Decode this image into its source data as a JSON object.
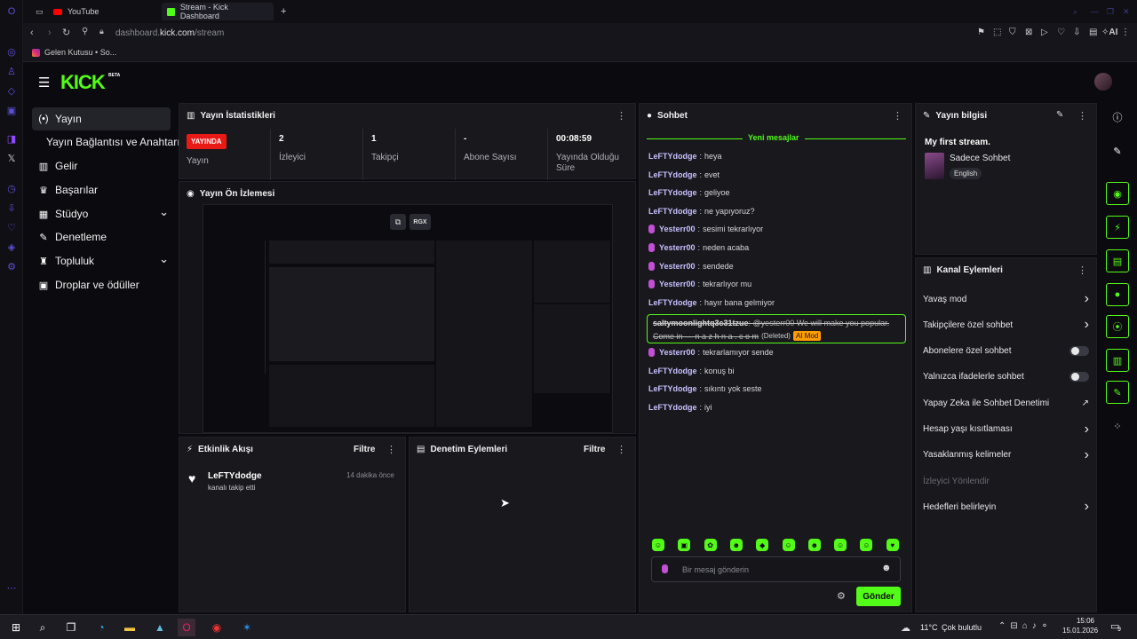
{
  "browser": {
    "tabs": [
      {
        "label": "YouTube"
      },
      {
        "label": "Stream - Kick Dashboard"
      }
    ],
    "new_tab_label": "+",
    "url_host": "dashboard.",
    "url_domain": "kick.com",
    "url_path": "/stream",
    "ai_label": "AI",
    "bookmark": "Gelen Kutusu • So..."
  },
  "kick": {
    "logo": "KICK",
    "beta": "BETA"
  },
  "sidebar": {
    "items": [
      {
        "label": "Yayın",
        "icon": "broadcast-icon"
      },
      {
        "label": "Yayın Bağlantısı ve Anahtarı",
        "icon": ""
      },
      {
        "label": "Gelir",
        "icon": "chart-icon"
      },
      {
        "label": "Başarılar",
        "icon": "trophy-icon"
      },
      {
        "label": "Stüdyo",
        "icon": "studio-icon",
        "chevron": "⌄"
      },
      {
        "label": "Denetleme",
        "icon": "wrench-icon"
      },
      {
        "label": "Topluluk",
        "icon": "community-icon",
        "chevron": "⌄"
      },
      {
        "label": "Droplar ve ödüller",
        "icon": "gift-icon"
      }
    ]
  },
  "stats": {
    "title": "Yayın İstatistikleri",
    "live_badge": "YAYINDA",
    "items": [
      {
        "value": "",
        "label": "Yayın"
      },
      {
        "value": "2",
        "label": "İzleyici"
      },
      {
        "value": "1",
        "label": "Takipçi"
      },
      {
        "value": "-",
        "label": "Abone Sayısı"
      },
      {
        "value": "00:08:59",
        "label": "Yayında Olduğu Süre"
      }
    ]
  },
  "preview": {
    "title": "Yayın Ön İzlemesi",
    "badge": "RGX"
  },
  "activity": {
    "title": "Etkinlik Akışı",
    "filter": "Filtre",
    "events": [
      {
        "user": "LeFTYdodge",
        "text": "kanalı takip etti",
        "time": "14 dakika önce"
      }
    ]
  },
  "moderation": {
    "title": "Denetim Eylemleri",
    "filter": "Filtre"
  },
  "chat": {
    "title": "Sohbet",
    "new_messages": "Yeni mesajlar",
    "messages": [
      {
        "user": "LeFTYdodge",
        "text": "heya",
        "mic": false
      },
      {
        "user": "LeFTYdodge",
        "text": "evet",
        "mic": false
      },
      {
        "user": "LeFTYdodge",
        "text": "geliyoe",
        "mic": false
      },
      {
        "user": "LeFTYdodge",
        "text": "ne yapıyoruz?",
        "mic": false
      },
      {
        "user": "Yesterr00",
        "text": "sesimi tekrarlıyor",
        "mic": true
      },
      {
        "user": "Yesterr00",
        "text": "neden acaba",
        "mic": true
      },
      {
        "user": "Yesterr00",
        "text": "sendede",
        "mic": true
      },
      {
        "user": "Yesterr00",
        "text": "tekrarlıyor mu",
        "mic": true
      },
      {
        "user": "LeFTYdodge",
        "text": "hayır bana gelmiyor",
        "mic": false
      }
    ],
    "deleted": {
      "user": "saltymoonlightq3c31tzue",
      "text1": "@yesterr00 We will make you popular.",
      "text2": "Come in — n a z h n a . c o m",
      "tag": "(Deleted)",
      "badge": "AI Mod"
    },
    "messages2": [
      {
        "user": "Yesterr00",
        "text": "tekrarlamıyor sende",
        "mic": true
      },
      {
        "user": "LeFTYdodge",
        "text": "konuş bi",
        "mic": false
      },
      {
        "user": "LeFTYdodge",
        "text": "sıkıntı yok seste",
        "mic": false
      },
      {
        "user": "LeFTYdodge",
        "text": "iyi",
        "mic": false
      }
    ],
    "placeholder": "Bir mesaj gönderin",
    "send": "Gönder"
  },
  "info": {
    "title": "Yayın bilgisi",
    "stream_title": "My first stream.",
    "category": "Sadece Sohbet",
    "language": "English"
  },
  "actions": {
    "title": "Kanal Eylemleri",
    "items": [
      {
        "label": "Yavaş mod",
        "type": "chevron"
      },
      {
        "label": "Takipçilere özel sohbet",
        "type": "chevron"
      },
      {
        "label": "Abonelere özel sohbet",
        "type": "toggle"
      },
      {
        "label": "Yalnızca ifadelerle sohbet",
        "type": "toggle"
      },
      {
        "label": "Yapay Zeka ile Sohbet Denetimi",
        "type": "external"
      },
      {
        "label": "Hesap yaşı kısıtlaması",
        "type": "chevron"
      },
      {
        "label": "Yasaklanmış kelimeler",
        "type": "chevron"
      },
      {
        "label": "İzleyici Yönlendir",
        "type": "disabled"
      },
      {
        "label": "Hedefleri belirleyin",
        "type": "chevron"
      }
    ]
  },
  "taskbar": {
    "weather": "11°C",
    "weather_text": "Çok bulutlu",
    "time": "15:06",
    "date": "15.01.2026",
    "notif": "9"
  },
  "colors": {
    "accent": "#53fc18",
    "live": "#e91916",
    "bg": "#0b0b0f",
    "panel": "#18181d"
  }
}
